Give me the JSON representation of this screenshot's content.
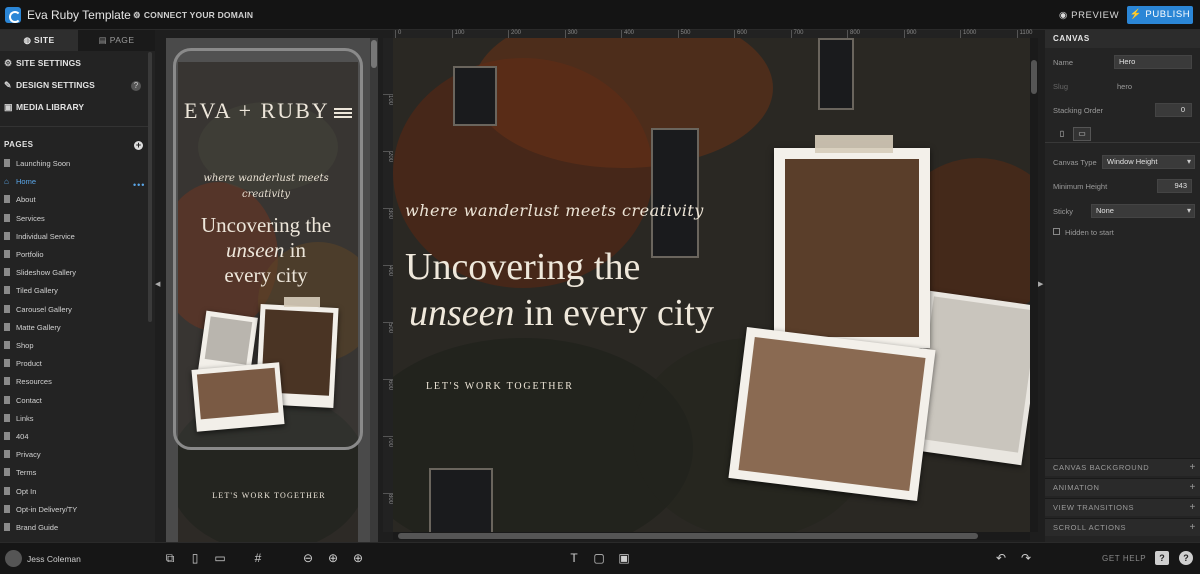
{
  "app": {
    "title": "Eva Ruby Template",
    "connect": "CONNECT YOUR DOMAIN",
    "preview": "PREVIEW",
    "publish": "PUBLISH"
  },
  "left": {
    "tabs": [
      "SITE",
      "PAGE"
    ],
    "nav": [
      "SITE SETTINGS",
      "DESIGN SETTINGS",
      "MEDIA LIBRARY"
    ],
    "pages_header": "PAGES",
    "pages": [
      "Launching Soon",
      "Home",
      "About",
      "Services",
      "Individual Service",
      "Portfolio",
      "Slideshow Gallery",
      "Tiled Gallery",
      "Carousel Gallery",
      "Matte Gallery",
      "Shop",
      "Product",
      "Resources",
      "Contact",
      "Links",
      "404",
      "Privacy",
      "Terms",
      "Opt In",
      "Opt-in Delivery/TY",
      "Brand Guide"
    ],
    "current_page": "Home"
  },
  "ruler": {
    "top": [
      "0",
      "100",
      "200",
      "300",
      "400",
      "500",
      "600",
      "700",
      "800",
      "900",
      "1000",
      "1100"
    ],
    "left": [
      "100",
      "200",
      "300",
      "400",
      "500",
      "600",
      "700",
      "800"
    ]
  },
  "mobile": {
    "logo": "EVA + RUBY",
    "script": "where wanderlust meets creativity",
    "head_line1": "Uncovering the",
    "head_italic": "unseen",
    "head_line2": "in",
    "head_line3": "every city",
    "button": "LET'S WORK TOGETHER"
  },
  "canvas": {
    "script": "where wanderlust meets creativity",
    "head_line1": "Uncovering the",
    "head_italic": "unseen",
    "head_line2": " in every city",
    "button": "LET'S WORK TOGETHER"
  },
  "inspector": {
    "header": "CANVAS",
    "name_label": "Name",
    "name_value": "Hero",
    "slug_label": "Slug",
    "slug_value": "hero",
    "stacking_label": "Stacking Order",
    "stacking_value": "0",
    "canvas_type_label": "Canvas Type",
    "canvas_type_value": "Window Height",
    "min_height_label": "Minimum Height",
    "min_height_value": "943",
    "sticky_label": "Sticky",
    "sticky_value": "None",
    "hidden_label": "Hidden to start",
    "sections": [
      "CANVAS BACKGROUND",
      "ANIMATION",
      "VIEW TRANSITIONS",
      "SCROLL ACTIONS"
    ]
  },
  "bottom": {
    "user": "Jess Coleman",
    "get_help": "GET HELP"
  },
  "colors": {
    "accent": "#2b86d6",
    "panel": "#232323",
    "link": "#5aa6e8"
  }
}
